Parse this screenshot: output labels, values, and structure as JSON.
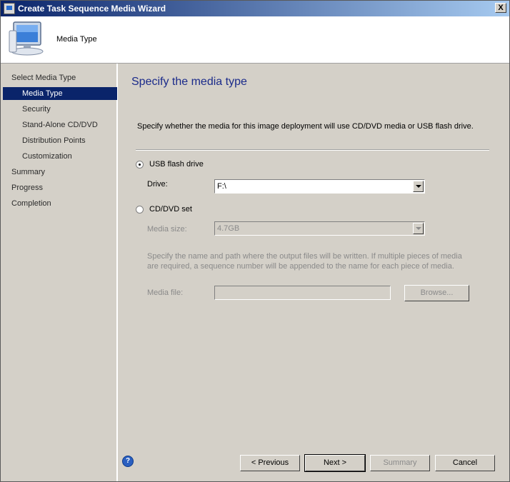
{
  "window": {
    "title": "Create Task Sequence Media Wizard",
    "close_label": "X"
  },
  "header": {
    "title": "Media Type",
    "icon": "computer-icon"
  },
  "sidebar": {
    "items": [
      {
        "label": "Select Media Type",
        "level": 0,
        "selected": false
      },
      {
        "label": "Media Type",
        "level": 1,
        "selected": true
      },
      {
        "label": "Security",
        "level": 1,
        "selected": false
      },
      {
        "label": "Stand-Alone CD/DVD",
        "level": 1,
        "selected": false
      },
      {
        "label": "Distribution Points",
        "level": 1,
        "selected": false
      },
      {
        "label": "Customization",
        "level": 1,
        "selected": false
      },
      {
        "label": "Summary",
        "level": 0,
        "selected": false
      },
      {
        "label": "Progress",
        "level": 0,
        "selected": false
      },
      {
        "label": "Completion",
        "level": 0,
        "selected": false
      }
    ]
  },
  "page": {
    "title": "Specify the media type",
    "description": "Specify whether the media for this image deployment will use CD/DVD media or USB flash drive.",
    "usb": {
      "label": "USB flash drive",
      "selected": true,
      "drive_label": "Drive:",
      "drive_value": "F:\\"
    },
    "cddvd": {
      "label": "CD/DVD set",
      "selected": false,
      "media_size_label": "Media size:",
      "media_size_value": "4.7GB",
      "info": "Specify the name and path where the output files will be written.  If multiple pieces of media are required, a sequence number will be appended to the name for each piece of media.",
      "media_file_label": "Media file:",
      "media_file_value": "",
      "browse_label": "Browse..."
    }
  },
  "footer": {
    "help_label": "?",
    "previous_label": "< Previous",
    "next_label": "Next >",
    "summary_label": "Summary",
    "cancel_label": "Cancel"
  },
  "colors": {
    "accent": "#0a246a",
    "title_text": "#1a2a8a"
  }
}
